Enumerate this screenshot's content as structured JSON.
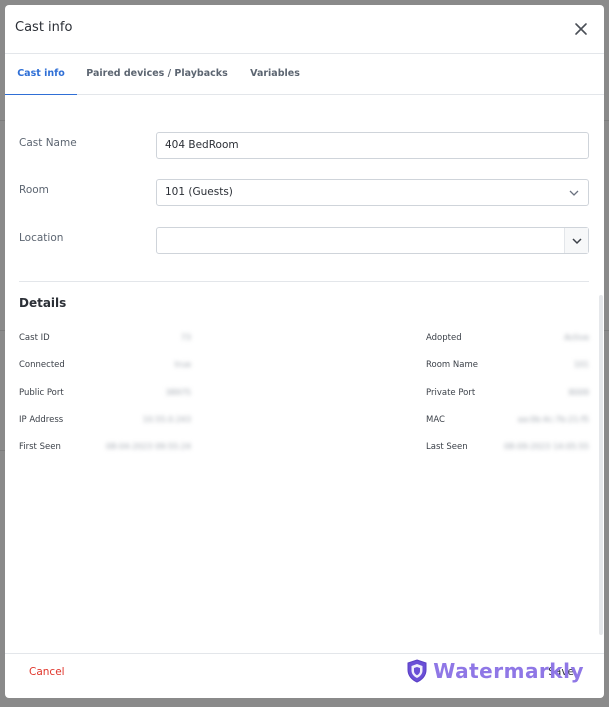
{
  "modal": {
    "title": "Cast info",
    "close_icon": "close-icon"
  },
  "tabs": [
    {
      "label": "Cast info",
      "active": true
    },
    {
      "label": "Paired devices / Playbacks",
      "active": false
    },
    {
      "label": "Variables",
      "active": false
    }
  ],
  "form": {
    "cast_name_label": "Cast Name",
    "cast_name_value": "404 BedRoom",
    "room_label": "Room",
    "room_value": "101 (Guests)",
    "location_label": "Location",
    "location_value": ""
  },
  "details": {
    "title": "Details",
    "left": [
      {
        "label": "Cast ID",
        "value": "73"
      },
      {
        "label": "Connected",
        "value": "true"
      },
      {
        "label": "Public Port",
        "value": "38975"
      },
      {
        "label": "IP Address",
        "value": "10.55.0.243"
      },
      {
        "label": "First Seen",
        "value": "08-04-2023 09:55:24"
      }
    ],
    "right": [
      {
        "label": "Adopted",
        "value": "Active"
      },
      {
        "label": "Room Name",
        "value": "101"
      },
      {
        "label": "Private Port",
        "value": "8009"
      },
      {
        "label": "MAC",
        "value": "aa:0b:4c:7b:21:f5"
      },
      {
        "label": "Last Seen",
        "value": "08-09-2023 14:05:55"
      }
    ]
  },
  "footer": {
    "cancel_label": "Cancel",
    "save_label": "Save",
    "watermark_text": "Watermarkly"
  },
  "colors": {
    "accent": "#2f6fd6",
    "danger": "#e0352b",
    "watermark": "#8f77e6"
  }
}
